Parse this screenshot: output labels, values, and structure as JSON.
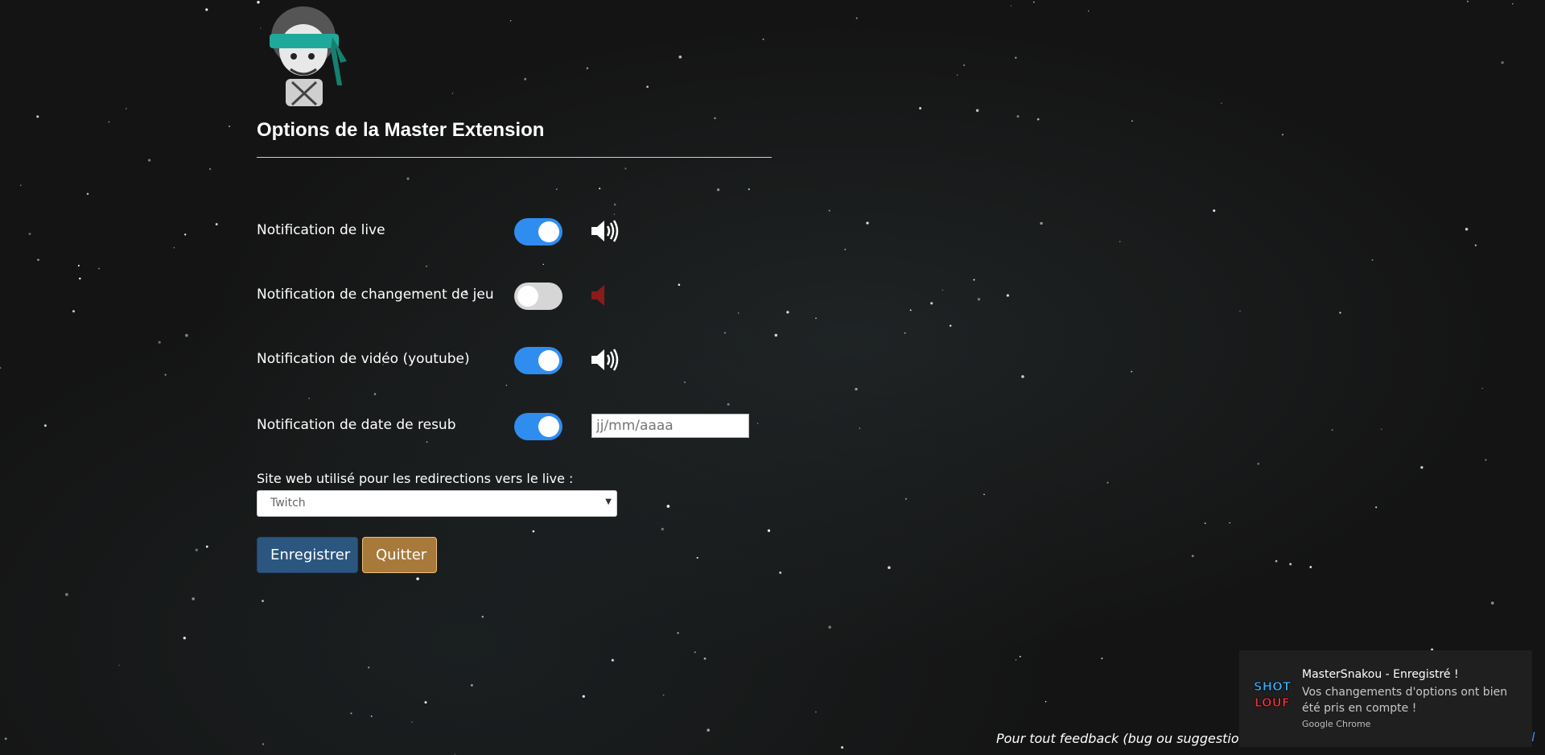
{
  "page": {
    "title": "Options de la Master Extension",
    "mascot_icon": "ninja-mascot-logo"
  },
  "notifications": [
    {
      "label": "Notification de live",
      "enabled": true,
      "sound": "on",
      "sound_icon": "speaker-on-icon"
    },
    {
      "label": "Notification de changement de jeu",
      "enabled": false,
      "sound": "muted",
      "sound_icon": "speaker-muted-icon"
    },
    {
      "label": "Notification de vidéo (youtube)",
      "enabled": true,
      "sound": "on",
      "sound_icon": "speaker-on-icon"
    },
    {
      "label": "Notification de date de resub",
      "enabled": true
    }
  ],
  "resub_date": {
    "value": "",
    "placeholder": "jj/mm/aaaa"
  },
  "website": {
    "label": "Site web utilisé pour les redirections vers le live :",
    "selected": "Twitch"
  },
  "buttons": {
    "save": "Enregistrer",
    "quit": "Quitter"
  },
  "footer": {
    "feedback": "Pour tout feedback (bug ou suggestions)",
    "link_fragment": "il"
  },
  "toast": {
    "title": "MasterSnakou - Enregistré !",
    "body": "Vos changements d'options ont bien été pris en compte !",
    "source": "Google Chrome",
    "logo_text_top": "SHOT",
    "logo_text_bottom": "LOUF"
  },
  "colors": {
    "toggle_on": "#2f8df0",
    "toggle_off": "#d6d6d6",
    "save_button": "#2b5680",
    "quit_button": "#a77a3c",
    "muted_speaker": "#8b1a1a"
  }
}
